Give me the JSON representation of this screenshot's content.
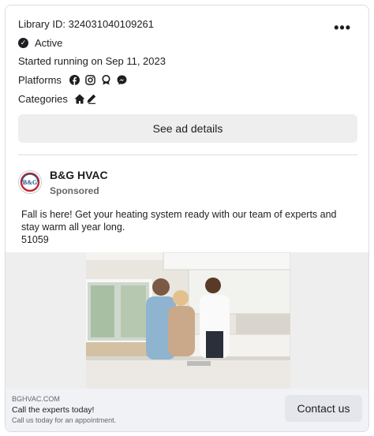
{
  "header": {
    "library_id": "Library ID: 324031040109261",
    "status": "Active",
    "started": "Started running on Sep 11, 2023",
    "platforms_label": "Platforms",
    "categories_label": "Categories",
    "platforms": [
      "facebook-icon",
      "instagram-icon",
      "audience-network-icon",
      "messenger-icon"
    ],
    "categories": [
      "housing-icon",
      "credit-icon"
    ]
  },
  "details_button": "See ad details",
  "advertiser": {
    "name": "B&G HVAC",
    "sponsored": "Sponsored",
    "avatar_text": "B&G"
  },
  "ad": {
    "text_line1": "Fall is here! Get your heating system ready with our team of experts and stay warm all year long.",
    "text_line2": "51059"
  },
  "footer": {
    "domain": "BGHVAC.COM",
    "headline": "Call the experts today!",
    "description": "Call us today for an appointment.",
    "cta": "Contact us"
  },
  "colors": {
    "text": "#1c1e21",
    "secondary": "#65676b",
    "button_bg": "#eeeeee",
    "footer_bg": "#f0f2f5",
    "brand_red": "#c0282d",
    "brand_blue": "#1f4e8c"
  }
}
